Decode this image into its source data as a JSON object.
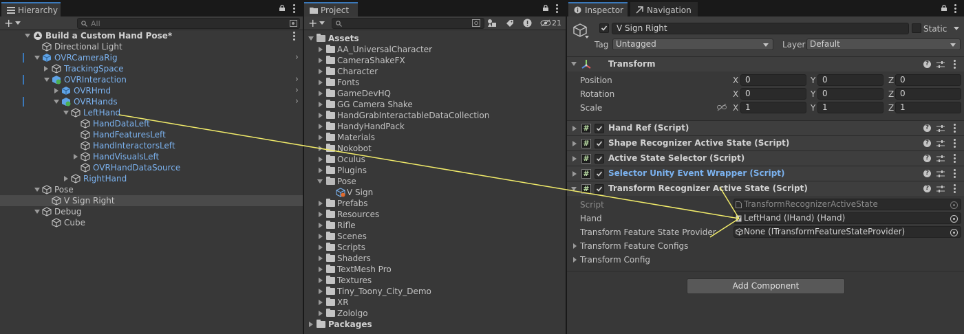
{
  "hierarchy": {
    "tab_label": "Hierarchy",
    "search_placeholder": "All",
    "scene_name": "Build a Custom Hand Pose*",
    "items": [
      {
        "label": "Directional Light"
      },
      {
        "label": "OVRCameraRig"
      },
      {
        "label": "TrackingSpace"
      },
      {
        "label": "OVRInteraction"
      },
      {
        "label": "OVRHmd"
      },
      {
        "label": "OVRHands"
      },
      {
        "label": "LeftHand"
      },
      {
        "label": "HandDataLeft"
      },
      {
        "label": "HandFeaturesLeft"
      },
      {
        "label": "HandInteractorsLeft"
      },
      {
        "label": "HandVisualsLeft"
      },
      {
        "label": "OVRHandDataSource"
      },
      {
        "label": "RightHand"
      },
      {
        "label": "Pose"
      },
      {
        "label": "V Sign Right"
      },
      {
        "label": "Debug"
      },
      {
        "label": "Cube"
      }
    ]
  },
  "project": {
    "tab_label": "Project",
    "hidden_count": "21",
    "assets_label": "Assets",
    "folders": [
      "AA_UniversalCharacter",
      "CameraShakeFX",
      "Character",
      "Fonts",
      "GameDevHQ",
      "GG Camera Shake",
      "HandGrabInteractableDataCollection",
      "HandyHandPack",
      "Materials",
      "Nokobot",
      "Oculus",
      "Plugins",
      "Pose",
      "V Sign",
      "Prefabs",
      "Resources",
      "Rifle",
      "Scenes",
      "Scripts",
      "Shaders",
      "TextMesh Pro",
      "Textures",
      "Tiny_Toony_City_Demo",
      "XR",
      "Zololgo"
    ],
    "packages_label": "Packages"
  },
  "inspector": {
    "tab_label": "Inspector",
    "nav_tab_label": "Navigation",
    "object_name": "V Sign Right",
    "static_label": "Static",
    "tag_label": "Tag",
    "tag_value": "Untagged",
    "layer_label": "Layer",
    "layer_value": "Default",
    "transform": {
      "title": "Transform",
      "position_label": "Position",
      "rotation_label": "Rotation",
      "scale_label": "Scale",
      "x": "X",
      "y": "Y",
      "z": "Z",
      "position": [
        "0",
        "0",
        "0"
      ],
      "rotation": [
        "0",
        "0",
        "0"
      ],
      "scale": [
        "1",
        "1",
        "1"
      ]
    },
    "components": [
      {
        "title": "Hand Ref (Script)"
      },
      {
        "title": "Shape Recognizer Active State (Script)"
      },
      {
        "title": "Active State Selector (Script)"
      },
      {
        "title": "Selector Unity Event Wrapper (Script)"
      },
      {
        "title": "Transform Recognizer Active State (Script)"
      }
    ],
    "trs": {
      "script_label": "Script",
      "script_value": "TransformRecognizerActiveState",
      "hand_label": "Hand",
      "hand_value": "LeftHand (IHand) (Hand)",
      "provider_label": "Transform Feature State Provider",
      "provider_value": "None (ITransformFeatureStateProvider)",
      "configs_label": "Transform Feature Configs",
      "config_label": "Transform Config"
    },
    "add_component": "Add Component"
  },
  "colors": {
    "accent": "#3a79bb",
    "link_blue": "#7bb2ef",
    "drag_line": "#f2ec6a"
  }
}
